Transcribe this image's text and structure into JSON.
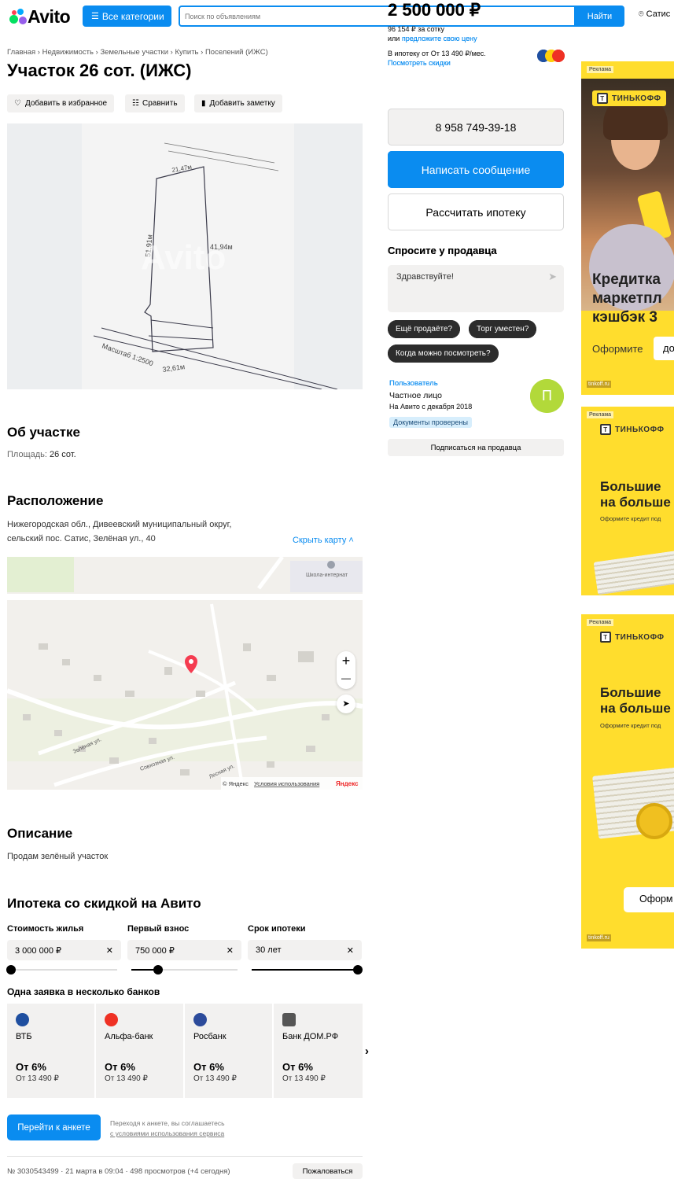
{
  "header": {
    "logo_text": "Avito",
    "categories_label": "Все категории",
    "search_placeholder": "Поиск по объявлениям",
    "find_label": "Найти",
    "location": "Сатис"
  },
  "breadcrumbs": [
    "Главная",
    "Недвижимость",
    "Земельные участки",
    "Купить",
    "Поселений (ИЖС)"
  ],
  "listing": {
    "title": "Участок 26 сот. (ИЖС)",
    "actions": {
      "favorite": "Добавить в избранное",
      "compare": "Сравнить",
      "note": "Добавить заметку"
    },
    "photo_watermark": "Avito",
    "photo_texts": {
      "scale": "Масштаб 1:2500",
      "dim1": "32,61м",
      "dim2": "51,91м",
      "dim3": "41,94м",
      "dim4": "21,47м"
    }
  },
  "about": {
    "heading": "Об участке",
    "area_label": "Площадь:",
    "area_value": "26 сот."
  },
  "location": {
    "heading": "Расположение",
    "address_line1": "Нижегородская обл., Дивеевский муниципальный округ,",
    "address_line2": "сельский пос. Сатис, Зелёная ул., 40",
    "hide_map": "Скрыть карту",
    "map": {
      "poi": "Школа-интернат",
      "streets": [
        "Зелёная ул.",
        "Совхозная ул.",
        "Лесная ул."
      ],
      "attribution": "© Яндекс",
      "terms": "Условия использования",
      "brand": "Яндекс",
      "zoom_in": "+",
      "zoom_out": "—"
    }
  },
  "description": {
    "heading": "Описание",
    "text": "Продам зелёный участок"
  },
  "mortgage": {
    "heading": "Ипотека со скидкой на Авито",
    "fields": [
      {
        "label": "Стоимость жилья",
        "value": "3 000 000 ₽",
        "slider": 0.0
      },
      {
        "label": "Первый взнос",
        "value": "750 000 ₽",
        "slider": 0.25
      },
      {
        "label": "Срок ипотеки",
        "value": "30 лет",
        "slider": 1.0
      }
    ],
    "banks_heading": "Одна заявка в несколько банков",
    "banks": [
      {
        "name": "ВТБ",
        "rate": "От 6%",
        "monthly": "От 13 490 ₽",
        "color": "#1f4fa0"
      },
      {
        "name": "Альфа-банк",
        "rate": "От 6%",
        "monthly": "От 13 490 ₽",
        "color": "#ef3124"
      },
      {
        "name": "Росбанк",
        "rate": "От 6%",
        "monthly": "От 13 490 ₽",
        "color": "#2c4b9b"
      },
      {
        "name": "Банк ДОМ.РФ",
        "rate": "От 6%",
        "monthly": "От 13 490 ₽",
        "color": "#555555"
      }
    ],
    "go_button": "Перейти к анкете",
    "consent_line1": "Переходя к анкете, вы соглашаетесь",
    "consent_line2": "с условиями использования сервиса"
  },
  "footer": {
    "meta": "№ 3030543499 · 21 марта в 09:04 · 498 просмотров (+4 сегодня)",
    "report": "Пожаловаться"
  },
  "sidebar": {
    "price": "2 500 000 ₽",
    "per_unit": "96 154 ₽ за сотку",
    "offer_prefix": "или",
    "offer_link": "предложите свою цену",
    "mortgage_text": "В ипотеку от От 13 490 ₽/мес.",
    "discounts_link": "Посмотреть скидки",
    "phone": "8 958 749-39-18",
    "message_button": "Написать сообщение",
    "calc_button": "Рассчитать ипотеку",
    "ask_heading": "Спросите у продавца",
    "ask_text": "Здравствуйте!",
    "chips": [
      "Ещё продаёте?",
      "Торг уместен?",
      "Когда можно посмотреть?"
    ],
    "seller_name": "Пользователь",
    "seller_type": "Частное лицо",
    "seller_since": "На Авито с декабря 2018",
    "docs_badge": "Документы проверены",
    "avatar_letter": "П",
    "subscribe": "Подписаться на продавца"
  },
  "ads": {
    "label": "Реклама",
    "brand": "ТИНЬКОФФ",
    "ad1_headline": [
      "Кредитка",
      "маркетпл",
      "кэшбэк 3"
    ],
    "ad1_cta_text": "Оформите",
    "ad1_cta_button": "до",
    "ad1_footer": "tinkoff.ru",
    "ad2_headline": [
      "Большие ",
      "на больше"
    ],
    "ad2_small": "Оформите кредит под",
    "ad3_headline": [
      "Большие ",
      "на больше"
    ],
    "ad3_small": "Оформите кредит под",
    "ad3_cta": "Оформ",
    "ad3_footer": "tinkoff.ru",
    "colors": {
      "yellow": "#ffdd2d"
    }
  },
  "colors": {
    "accent": "#0a8cf0",
    "avatar": "#b2d93a",
    "dark_chip": "#2c2c2c"
  }
}
